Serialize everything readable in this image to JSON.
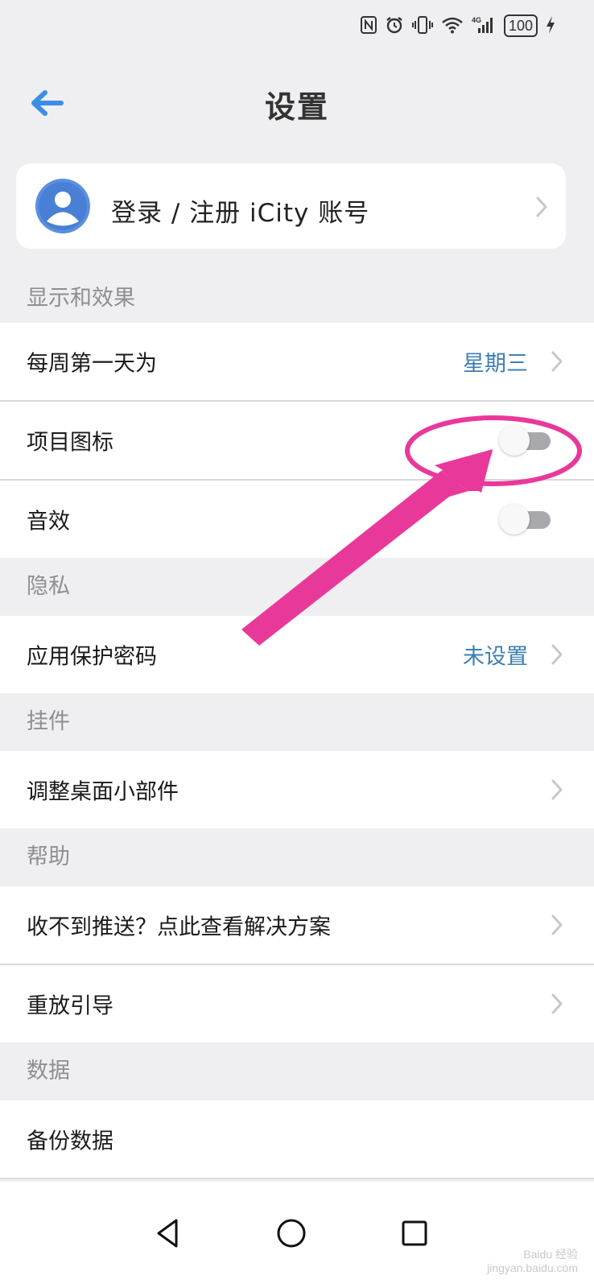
{
  "status_bar": {
    "icons": [
      "nfc-icon",
      "alarm-icon",
      "vibrate-icon",
      "wifi-icon",
      "signal-4g-icon",
      "battery-icon",
      "charging-icon"
    ],
    "network": "4G",
    "battery": "100"
  },
  "header": {
    "title": "设置",
    "back_icon": "arrow-left-icon"
  },
  "account": {
    "label": "登录 / 注册 iCity 账号",
    "avatar_icon": "user-avatar-icon"
  },
  "sections": {
    "display": {
      "title": "显示和效果",
      "first_day_label": "每周第一天为",
      "first_day_value": "星期三",
      "project_icon_label": "项目图标",
      "project_icon_on": false,
      "sound_label": "音效",
      "sound_on": false
    },
    "privacy": {
      "title": "隐私",
      "password_label": "应用保护密码",
      "password_value": "未设置"
    },
    "widgets": {
      "title": "挂件",
      "adjust_label": "调整桌面小部件"
    },
    "help": {
      "title": "帮助",
      "push_label": "收不到推送？点此查看解决方案",
      "replay_label": "重放引导"
    },
    "data": {
      "title": "数据",
      "backup_label": "备份数据"
    }
  },
  "nav": {
    "back": "triangle-back-icon",
    "home": "circle-home-icon",
    "recents": "square-recents-icon"
  },
  "annotation": {
    "color": "#e8399a"
  },
  "watermark": {
    "line1": "Bai",
    "line2": "du 经验",
    "line3": "jingyan.baidu.com"
  },
  "colors": {
    "accent_blue": "#3a8ee6",
    "value_blue": "#3d7fb3",
    "background": "#efeef0"
  }
}
